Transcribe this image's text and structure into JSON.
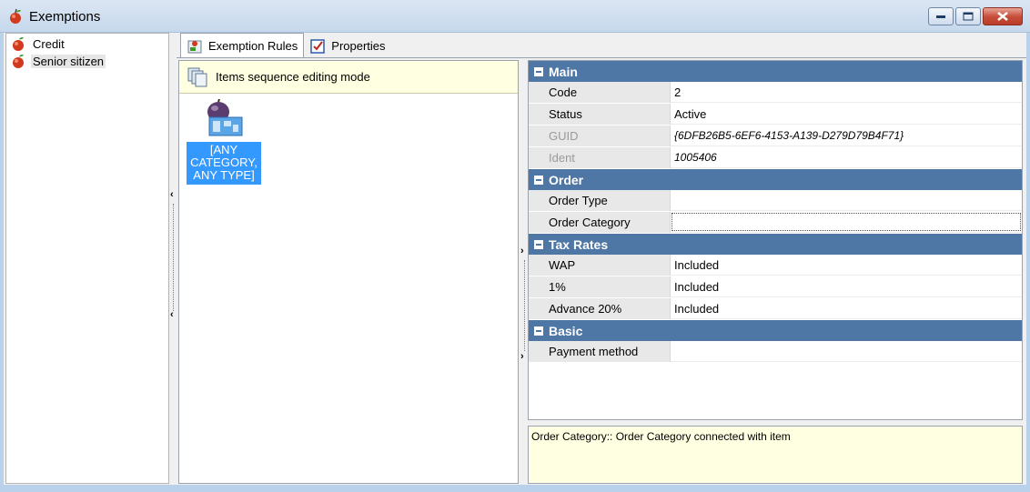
{
  "window": {
    "title": "Exemptions",
    "icon": "apple-icon"
  },
  "tree": {
    "items": [
      {
        "label": "Credit",
        "icon": "apple-icon",
        "selected": false
      },
      {
        "label": "Senior sitizen",
        "icon": "apple-icon",
        "selected": true
      }
    ]
  },
  "tabs": [
    {
      "label": "Exemption Rules",
      "icon": "rules-icon",
      "active": true
    },
    {
      "label": "Properties",
      "icon": "properties-icon",
      "active": false
    }
  ],
  "rules_panel": {
    "header": "Items sequence editing mode",
    "item_label_lines": [
      "[ANY",
      "CATEGORY,",
      "ANY TYPE]"
    ]
  },
  "property_grid": {
    "main": {
      "title": "Main",
      "rows": [
        {
          "name": "Code",
          "value": "2"
        },
        {
          "name": "Status",
          "value": "Active"
        },
        {
          "name": "GUID",
          "value": "{6DFB26B5-6EF6-4153-A139-D279D79B4F71}"
        },
        {
          "name": "Ident",
          "value": "1005406"
        }
      ]
    },
    "order": {
      "title": "Order",
      "rows": [
        {
          "name": "Order Type",
          "value": ""
        },
        {
          "name": "Order Category",
          "value": ""
        }
      ]
    },
    "tax_rates": {
      "title": "Tax Rates",
      "rows": [
        {
          "name": "WAP",
          "value": "Included"
        },
        {
          "name": "1%",
          "value": "Included"
        },
        {
          "name": "Advance 20%",
          "value": "Included"
        }
      ]
    },
    "basic": {
      "title": "Basic",
      "rows": [
        {
          "name": "Payment method",
          "value": ""
        }
      ]
    }
  },
  "description": "Order Category:: Order Category connected with item"
}
